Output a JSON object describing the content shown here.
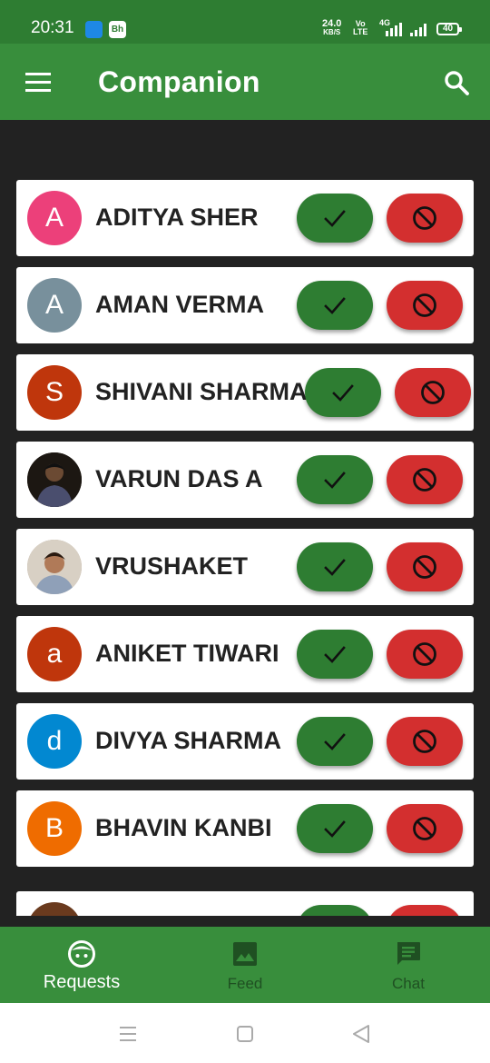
{
  "status_bar": {
    "time": "20:31",
    "speed_value": "24.0",
    "speed_unit": "KB/S",
    "volte_top": "Vo",
    "volte_bottom": "LTE",
    "network": "4G",
    "battery": "40"
  },
  "app_bar": {
    "title": "Companion",
    "menu_icon": "hamburger-menu-icon",
    "search_icon": "search-icon"
  },
  "requests": [
    {
      "name": "ADITYA SHER",
      "avatar_letter": "A",
      "avatar_color": "#ec407a"
    },
    {
      "name": "AMAN VERMA",
      "avatar_letter": "A",
      "avatar_color": "#78909c"
    },
    {
      "name": "SHIVANI SHARMA",
      "avatar_letter": "S",
      "avatar_color": "#bf360c"
    },
    {
      "name": "VARUN DAS A",
      "avatar_letter": "",
      "avatar_color": "#3a2e25"
    },
    {
      "name": "VRUSHAKET",
      "avatar_letter": "",
      "avatar_color": "#b0a090"
    },
    {
      "name": "ANIKET TIWARI",
      "avatar_letter": "a",
      "avatar_color": "#bf360c"
    },
    {
      "name": "DIVYA SHARMA",
      "avatar_letter": "d",
      "avatar_color": "#0288d1"
    },
    {
      "name": "BHAVIN KANBI",
      "avatar_letter": "B",
      "avatar_color": "#ef6c00"
    }
  ],
  "actions": {
    "accept_icon": "check-icon",
    "reject_icon": "block-icon"
  },
  "bottom_nav": [
    {
      "label": "Requests",
      "icon": "face-icon",
      "active": true
    },
    {
      "label": "Feed",
      "icon": "image-icon",
      "active": false
    },
    {
      "label": "Chat",
      "icon": "chat-icon",
      "active": false
    }
  ],
  "colors": {
    "primary": "#388e3c",
    "status_bar": "#2e7d32",
    "accept": "#2e7d32",
    "reject": "#d32f2f",
    "background": "#222222"
  }
}
